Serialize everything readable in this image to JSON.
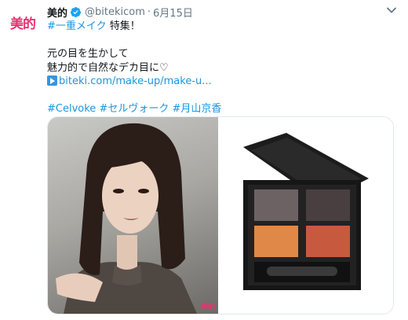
{
  "account": {
    "avatar_text": "美的",
    "display_name": "美的",
    "handle": "@bitekicom",
    "separator": "·",
    "date": "6月15日"
  },
  "tweet": {
    "hashtag_single_eyelid": "#一重メイク",
    "title_suffix": " 特集！",
    "line_1": "元の目を生かして",
    "line_2": "魅力的で自然なデカ目に♡",
    "url": "biteki.com/make-up/make-u...",
    "hashtags": [
      "#Celvoke",
      "#セルヴォーク",
      "#月山京香"
    ]
  },
  "media": {
    "watermark": "美的"
  },
  "icons": {
    "verified": "verified-badge-icon",
    "more": "chevron-down-icon",
    "link": "link-arrow-icon"
  },
  "colors": {
    "link": "#1b95e0",
    "brand_pink": "#e8336f",
    "muted": "#657786"
  }
}
